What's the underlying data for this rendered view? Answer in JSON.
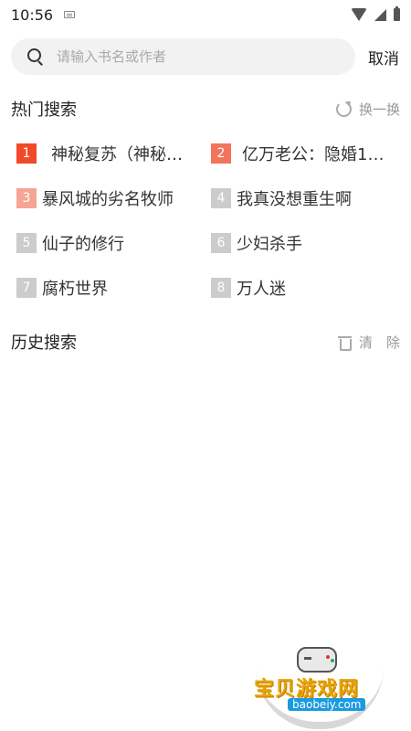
{
  "status_bar": {
    "time": "10:56",
    "icons": [
      "keyboard-icon",
      "wifi-icon",
      "signal-icon",
      "battery-icon"
    ]
  },
  "search": {
    "placeholder": "请输入书名或作者",
    "value": "",
    "cancel_label": "取消"
  },
  "hot_search": {
    "title": "热门搜索",
    "refresh_label": "换一换",
    "items": [
      {
        "rank": "1",
        "text": "神秘复苏（神秘…",
        "color": "#f04a2a"
      },
      {
        "rank": "2",
        "text": "亿万老公：隐婚1…",
        "color": "#f2745a"
      },
      {
        "rank": "3",
        "text": "暴风城的劣名牧师",
        "color": "#f5a595"
      },
      {
        "rank": "4",
        "text": "我真没想重生啊",
        "color": "#cccccc"
      },
      {
        "rank": "5",
        "text": "仙子的修行",
        "color": "#cccccc"
      },
      {
        "rank": "6",
        "text": "少妇杀手",
        "color": "#cccccc"
      },
      {
        "rank": "7",
        "text": "腐朽世界",
        "color": "#cccccc"
      },
      {
        "rank": "8",
        "text": "万人迷",
        "color": "#cccccc"
      }
    ]
  },
  "history": {
    "title": "历史搜索",
    "clear_label": "清　除"
  },
  "watermark": {
    "title": "宝贝游戏网",
    "url": "baobeiy.com"
  }
}
